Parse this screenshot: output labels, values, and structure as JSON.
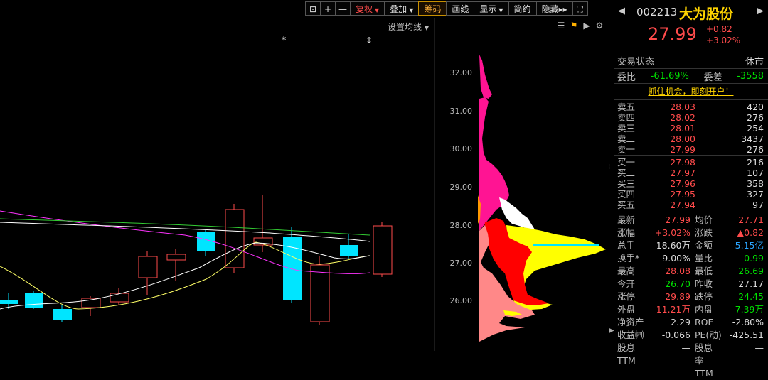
{
  "toolbar": {
    "lock_icon": "lock-icon",
    "plus": "+",
    "minus": "—",
    "fuquan": "复权",
    "diejia": "叠加",
    "chouma": "筹码",
    "huaxian": "画线",
    "xianshi": "显示",
    "jianyue": "简约",
    "yincang": "隐藏",
    "yincang_suffix": "▸▸",
    "fullscreen_icon": "fullscreen-icon"
  },
  "chart": {
    "settings_label": "设置均线",
    "markers": [
      "*",
      "↕"
    ],
    "depth_price_labels": [
      "32.00",
      "31.00",
      "30.00",
      "29.00",
      "28.00",
      "27.00",
      "26.00"
    ]
  },
  "stock": {
    "code": "002213",
    "name": "大为股份",
    "price": "27.99",
    "change": "+0.82",
    "change_pct": "+3.02%"
  },
  "state": {
    "label": "交易状态",
    "value": "休市",
    "weibi_label": "委比",
    "weibi_value": "-61.69%",
    "weicha_label": "委差",
    "weicha_value": "-3558"
  },
  "ad": "抓住机会，即刻开户！",
  "asks": [
    {
      "label": "卖五",
      "price": "28.03",
      "vol": "420"
    },
    {
      "label": "卖四",
      "price": "28.02",
      "vol": "276"
    },
    {
      "label": "卖三",
      "price": "28.01",
      "vol": "254"
    },
    {
      "label": "卖二",
      "price": "28.00",
      "vol": "3437"
    },
    {
      "label": "卖一",
      "price": "27.99",
      "vol": "276"
    }
  ],
  "bids": [
    {
      "label": "买一",
      "price": "27.98",
      "vol": "216"
    },
    {
      "label": "买二",
      "price": "27.97",
      "vol": "107"
    },
    {
      "label": "买三",
      "price": "27.96",
      "vol": "358"
    },
    {
      "label": "买四",
      "price": "27.95",
      "vol": "327"
    },
    {
      "label": "买五",
      "price": "27.94",
      "vol": "97"
    }
  ],
  "quote": [
    {
      "l1": "最新",
      "v1": "27.99",
      "c1": "red",
      "l2": "均价",
      "v2": "27.71",
      "c2": "red"
    },
    {
      "l1": "涨幅",
      "v1": "+3.02%",
      "c1": "red",
      "l2": "涨跌",
      "v2": "▲0.82",
      "c2": "red"
    },
    {
      "l1": "总手",
      "v1": "18.60万",
      "c1": "white",
      "l2": "金额",
      "v2": "5.15亿",
      "c2": "blue"
    },
    {
      "l1": "换手*",
      "v1": "9.00%",
      "c1": "white",
      "l2": "量比",
      "v2": "0.99",
      "c2": "green"
    },
    {
      "l1": "最高",
      "v1": "28.08",
      "c1": "red",
      "l2": "最低",
      "v2": "26.69",
      "c2": "green"
    },
    {
      "l1": "今开",
      "v1": "26.70",
      "c1": "green",
      "l2": "昨收",
      "v2": "27.17",
      "c2": "white"
    },
    {
      "l1": "涨停",
      "v1": "29.89",
      "c1": "red",
      "l2": "跌停",
      "v2": "24.45",
      "c2": "green"
    },
    {
      "l1": "外盘",
      "v1": "11.21万",
      "c1": "red",
      "l2": "内盘",
      "v2": "7.39万",
      "c2": "green"
    },
    {
      "l1": "净资产",
      "v1": "2.29",
      "c1": "white",
      "l2": "ROE",
      "v2": "-2.80%",
      "c2": "white"
    },
    {
      "l1": "收益㈣",
      "v1": "-0.066",
      "c1": "white",
      "l2": "PE(动)",
      "v2": "-425.51",
      "c2": "white"
    },
    {
      "l1": "股息TTM",
      "v1": "—",
      "c1": "white",
      "l2": "股息率TTM",
      "v2": "—",
      "c2": "white"
    }
  ],
  "colors": {
    "up": "#ff4b4b",
    "down": "#00e5ff",
    "ma5": "#ffffff",
    "ma10": "#ffff66",
    "ma20": "#ff33ff",
    "ma60": "#33cc33",
    "profit_chip": "#ff0000",
    "loss_chip": "#ffff00"
  }
}
